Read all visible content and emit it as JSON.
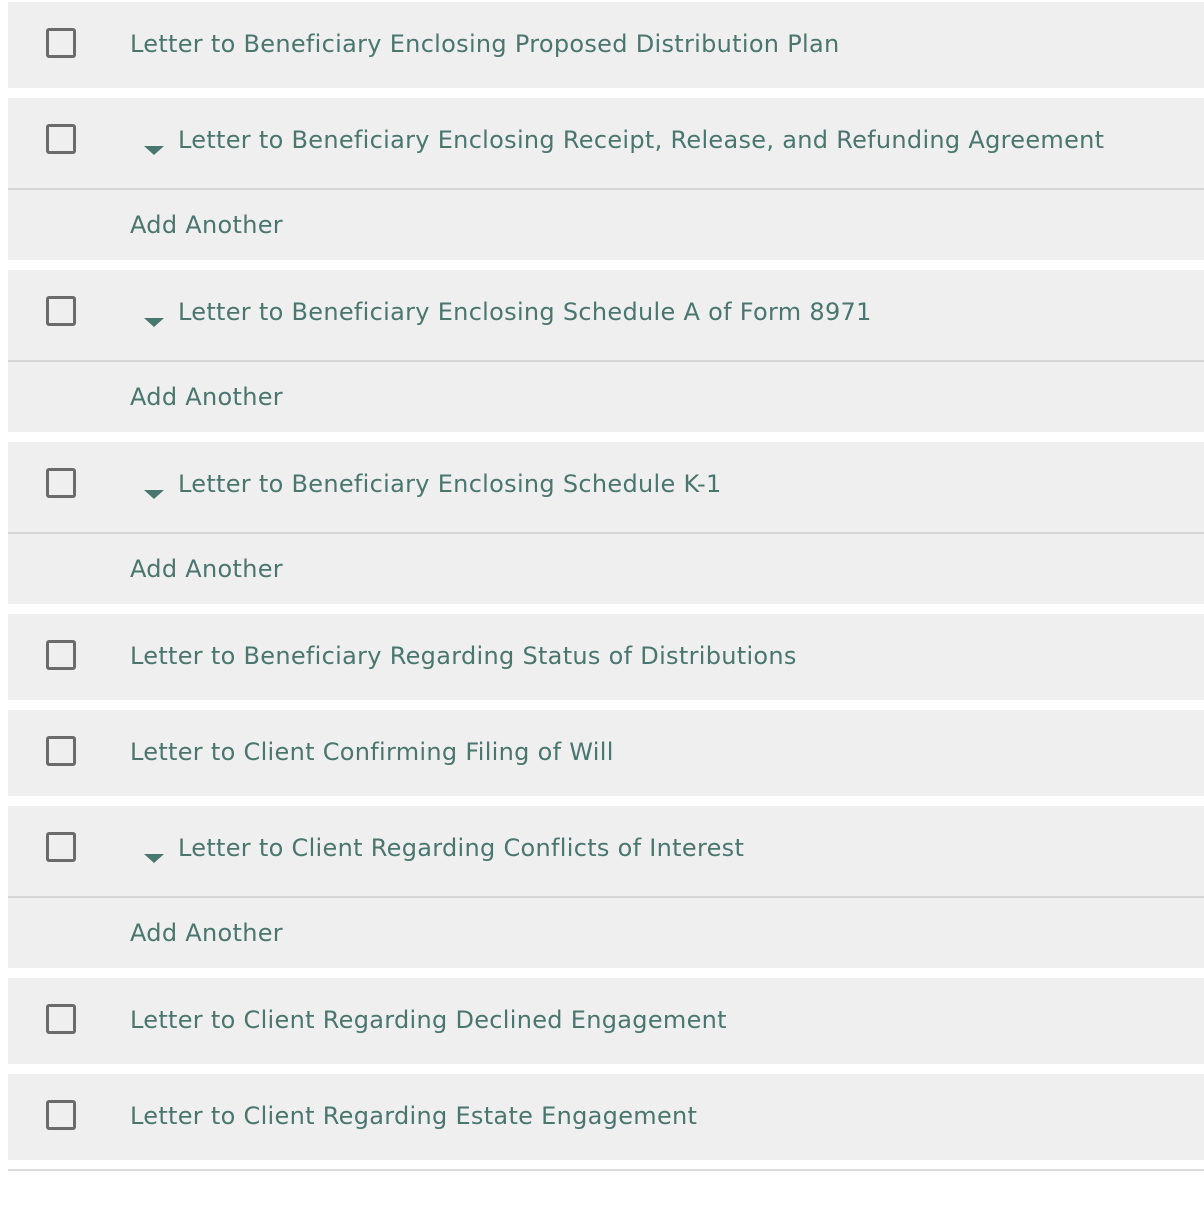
{
  "colors": {
    "row_bg": "#efefef",
    "text": "#4a7670",
    "checkbox_border": "#6b6b6b",
    "divider": "#d6d6d6"
  },
  "add_another_label": "Add Another",
  "items": [
    {
      "label": "Letter to Beneficiary Enclosing Proposed Distribution Plan",
      "expandable": false,
      "checked": false
    },
    {
      "label": "Letter to Beneficiary Enclosing Receipt, Release, and Refunding Agreement",
      "expandable": true,
      "checked": false,
      "add_label": "Add Another",
      "icon": "caret-down-icon"
    },
    {
      "label": "Letter to Beneficiary Enclosing Schedule A of Form 8971",
      "expandable": true,
      "checked": false,
      "add_label": "Add Another",
      "icon": "caret-down-icon"
    },
    {
      "label": "Letter to Beneficiary Enclosing Schedule K-1",
      "expandable": true,
      "checked": false,
      "add_label": "Add Another",
      "icon": "caret-down-icon"
    },
    {
      "label": "Letter to Beneficiary Regarding Status of Distributions",
      "expandable": false,
      "checked": false
    },
    {
      "label": "Letter to Client Confirming Filing of Will",
      "expandable": false,
      "checked": false
    },
    {
      "label": "Letter to Client Regarding Conflicts of Interest",
      "expandable": true,
      "checked": false,
      "add_label": "Add Another",
      "icon": "caret-down-icon"
    },
    {
      "label": "Letter to Client Regarding Declined Engagement",
      "expandable": false,
      "checked": false
    },
    {
      "label": "Letter to Client Regarding Estate Engagement",
      "expandable": false,
      "checked": false
    }
  ]
}
